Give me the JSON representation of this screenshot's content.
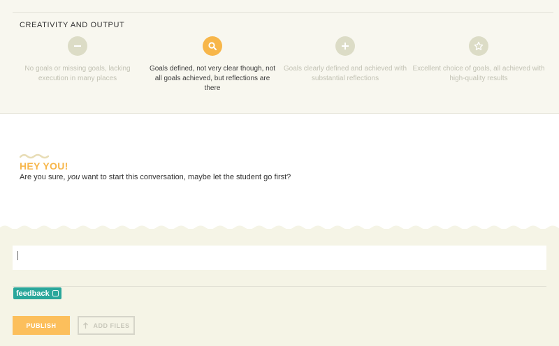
{
  "rubric": {
    "title": "CREATIVITY AND OUTPUT",
    "selected_level": 2,
    "levels": [
      {
        "icon": "minus-icon",
        "description": "No goals or missing goals, lacking execution in many places"
      },
      {
        "icon": "search-icon",
        "description": "Goals defined, not very clear though, not all goals achieved, but reflections are there"
      },
      {
        "icon": "plus-icon",
        "description": "Goals clearly defined and achieved with substantial reflections"
      },
      {
        "icon": "star-icon",
        "description": "Excellent choice of goals, all achieved with high-quality results"
      }
    ]
  },
  "notice": {
    "title": "HEY YOU!",
    "message_before": "Are you sure, ",
    "message_emphasis": "you",
    "message_after": " want to start this conversation, maybe let the student go first?"
  },
  "composer": {
    "value": "",
    "tags": [
      {
        "label": "feedback"
      }
    ],
    "publish_label": "PUBLISH",
    "add_files_label": "ADD FILES"
  },
  "colors": {
    "accent": "#f7b64a",
    "tag": "#2aa79b",
    "panel_bg": "#f8f7ef"
  }
}
